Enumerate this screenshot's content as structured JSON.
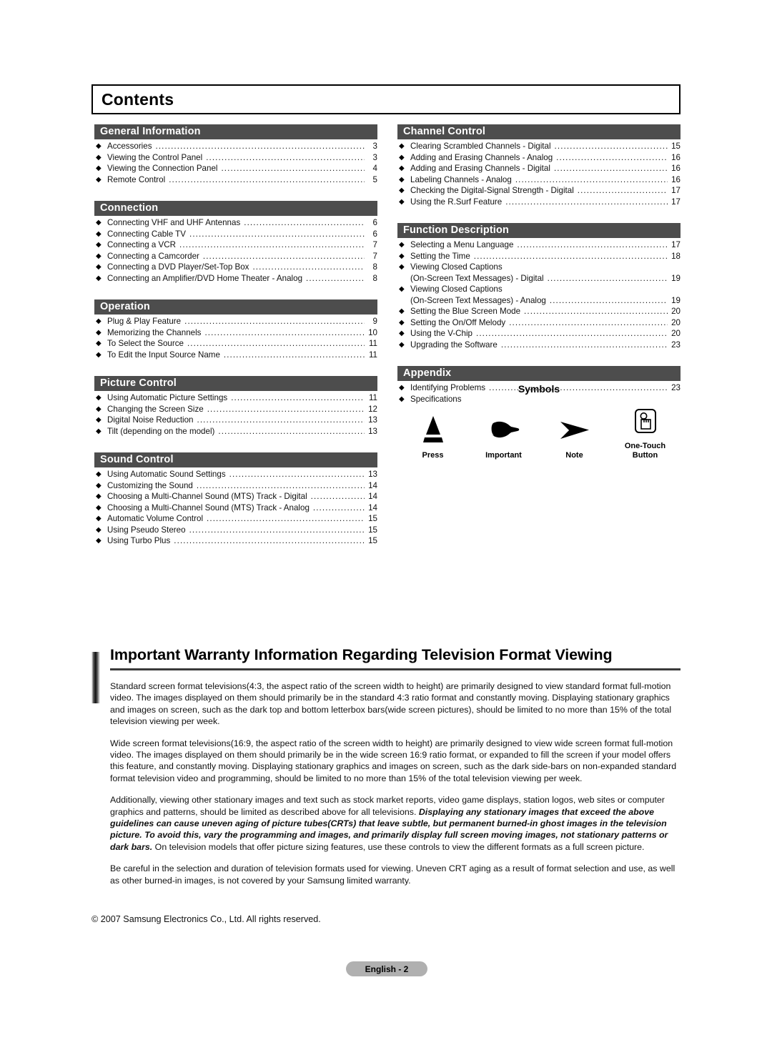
{
  "page": {
    "heading": "Contents",
    "copyright": "© 2007 Samsung Electronics Co., Ltd. All rights reserved.",
    "page_badge": "English - 2"
  },
  "toc": {
    "left_column": [
      {
        "title": "General Information",
        "entries": [
          {
            "text": "Accessories",
            "page": "3"
          },
          {
            "text": "Viewing the Control Panel",
            "page": "3"
          },
          {
            "text": "Viewing the Connection Panel",
            "page": "4"
          },
          {
            "text": "Remote Control",
            "page": "5"
          }
        ]
      },
      {
        "title": "Connection",
        "entries": [
          {
            "text": "Connecting VHF and UHF Antennas",
            "page": "6"
          },
          {
            "text": "Connecting Cable TV",
            "page": "6"
          },
          {
            "text": "Connecting a VCR",
            "page": "7"
          },
          {
            "text": "Connecting a Camcorder",
            "page": "7"
          },
          {
            "text": "Connecting a DVD Player/Set-Top Box",
            "page": "8"
          },
          {
            "text": "Connecting an Amplifier/DVD Home Theater - Analog",
            "page": "8"
          }
        ]
      },
      {
        "title": "Operation",
        "entries": [
          {
            "text": "Plug & Play Feature",
            "page": "9"
          },
          {
            "text": "Memorizing the Channels",
            "page": "10"
          },
          {
            "text": "To Select the Source",
            "page": "11"
          },
          {
            "text": "To Edit the Input Source Name",
            "page": "11"
          }
        ]
      },
      {
        "title": "Picture Control",
        "entries": [
          {
            "text": "Using Automatic Picture Settings",
            "page": "11"
          },
          {
            "text": "Changing the Screen Size",
            "page": "12"
          },
          {
            "text": "Digital Noise Reduction",
            "page": "13"
          },
          {
            "text": "Tilt (depending on the model)",
            "page": "13"
          }
        ]
      },
      {
        "title": "Sound Control",
        "entries": [
          {
            "text": "Using Automatic Sound Settings",
            "page": "13"
          },
          {
            "text": "Customizing the Sound",
            "page": "14"
          },
          {
            "text": "Choosing a Multi-Channel Sound (MTS) Track - Digital",
            "page": "14"
          },
          {
            "text": "Choosing a Multi-Channel Sound (MTS) Track - Analog",
            "page": "14"
          },
          {
            "text": "Automatic Volume Control",
            "page": "15"
          },
          {
            "text": "Using Pseudo Stereo",
            "page": "15"
          },
          {
            "text": "Using Turbo Plus",
            "page": "15"
          }
        ]
      }
    ],
    "right_column": [
      {
        "title": "Channel Control",
        "entries": [
          {
            "text": "Clearing Scrambled Channels - Digital",
            "page": "15"
          },
          {
            "text": "Adding and Erasing Channels - Analog",
            "page": "16"
          },
          {
            "text": "Adding and Erasing Channels - Digital",
            "page": "16"
          },
          {
            "text": "Labeling Channels - Analog",
            "page": "16"
          },
          {
            "text": "Checking the Digital-Signal Strength - Digital",
            "page": "17"
          },
          {
            "text": "Using the R.Surf Feature",
            "page": "17"
          }
        ]
      },
      {
        "title": "Function Description",
        "entries": [
          {
            "text": "Selecting a Menu Language",
            "page": "17"
          },
          {
            "text": "Setting the Time",
            "page": "18"
          },
          {
            "text": "Viewing Closed Captions",
            "page": "",
            "nodots": true
          },
          {
            "text": "(On-Screen Text Messages) - Digital",
            "page": "19",
            "continuation": true
          },
          {
            "text": "Viewing Closed Captions",
            "page": "",
            "nodots": true
          },
          {
            "text": "(On-Screen Text Messages) - Analog",
            "page": "19",
            "continuation": true
          },
          {
            "text": "Setting the Blue Screen Mode",
            "page": "20"
          },
          {
            "text": "Setting the On/Off Melody",
            "page": "20"
          },
          {
            "text": "Using the V-Chip",
            "page": "20"
          },
          {
            "text": "Upgrading the Software",
            "page": "23"
          }
        ]
      },
      {
        "title": "Appendix",
        "entries": [
          {
            "text": "Identifying Problems",
            "page": "23"
          },
          {
            "text": "Specifications",
            "page": "",
            "nodots": true
          }
        ]
      }
    ]
  },
  "symbols": {
    "title": "Symbols",
    "items": [
      {
        "icon": "press-triangle-icon",
        "label": "Press"
      },
      {
        "icon": "pointing-hand-icon",
        "label": "Important"
      },
      {
        "icon": "arrow-note-icon",
        "label": "Note"
      },
      {
        "icon": "one-touch-button-icon",
        "label": "One-Touch\nButton"
      }
    ]
  },
  "warranty": {
    "title": "Important Warranty Information Regarding Television Format Viewing",
    "paragraphs": [
      {
        "runs": [
          {
            "text": "Standard screen format televisions(4:3, the aspect ratio of the screen width to height) are primarily designed to view standard format full-motion video. The images displayed on them should primarily be in the standard 4:3 ratio format and constantly moving. Displaying stationary graphics and images on screen, such as the dark top and bottom letterbox bars(wide screen pictures), should be limited to no more than 15% of the total television viewing per week.",
            "style": "normal"
          }
        ]
      },
      {
        "runs": [
          {
            "text": "Wide screen format televisions(16:9, the aspect ratio of the screen width to height) are primarily designed to view wide screen format full-motion video. The images displayed on them should primarily be in the wide screen 16:9 ratio format, or expanded to fill the screen if your model offers this feature, and constantly moving. Displaying stationary graphics and images on screen, such as the dark side-bars on non-expanded standard format television video and programming, should be limited to no more than 15% of the total television viewing per week.",
            "style": "normal"
          }
        ]
      },
      {
        "runs": [
          {
            "text": "Additionally, viewing other stationary images and text such as stock market reports, video game displays, station logos, web sites or computer graphics and patterns, should be limited as described above for all televisions. ",
            "style": "normal"
          },
          {
            "text": "Displaying any stationary images that exceed the above guidelines can cause uneven aging of picture tubes(CRTs) that leave subtle, but permanent burned-in ghost images in the television picture. To avoid this, vary the programming and images, and primarily display full screen moving images, not stationary patterns or dark bars.",
            "style": "bold-italic"
          },
          {
            "text": " On television models that offer picture sizing features, use these controls to view the different formats as a full screen picture.",
            "style": "normal"
          }
        ]
      },
      {
        "runs": [
          {
            "text": "Be careful in the selection and duration of television formats used for viewing. Uneven CRT aging as a result of format selection and use, as well as other burned-in images, is not covered by your Samsung limited warranty.",
            "style": "normal"
          }
        ]
      }
    ]
  },
  "colors": {
    "section_header_bg": "#4d4d4d",
    "section_header_text": "#ffffff",
    "badge_bg": "#b0b0b0",
    "body_text": "#111111"
  }
}
